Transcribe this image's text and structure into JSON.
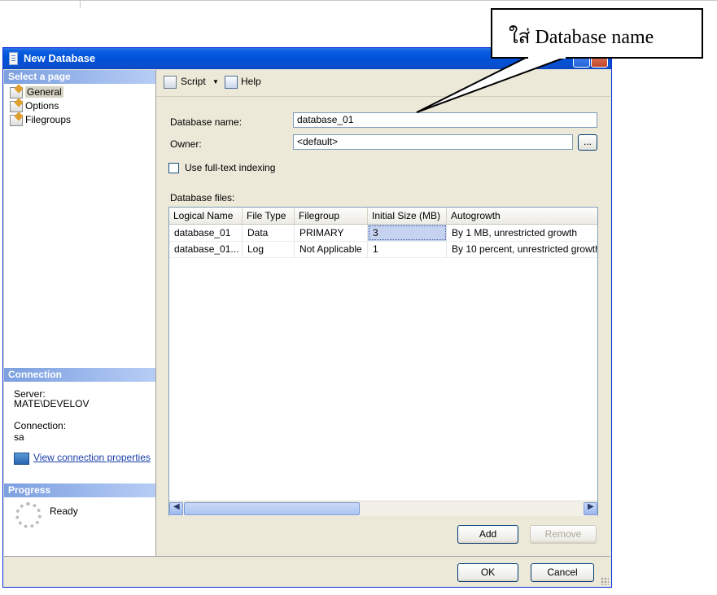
{
  "window": {
    "title": "New Database"
  },
  "left_panel": {
    "select_page_header": "Select a page",
    "pages": [
      {
        "label": "General",
        "selected": true
      },
      {
        "label": "Options",
        "selected": false
      },
      {
        "label": "Filegroups",
        "selected": false
      }
    ],
    "connection_header": "Connection",
    "server_label": "Server:",
    "server_value": "MATE\\DEVELOV",
    "connection_label": "Connection:",
    "connection_value": "sa",
    "view_properties_link": "View connection properties",
    "progress_header": "Progress",
    "progress_status": "Ready"
  },
  "toolbar": {
    "script_label": "Script",
    "help_label": "Help"
  },
  "form": {
    "database_name_label": "Database name:",
    "database_name_value": "database_01",
    "owner_label": "Owner:",
    "owner_value": "<default>",
    "browse_button": "...",
    "fulltext_label": "Use full-text indexing",
    "fulltext_checked": false,
    "database_files_label": "Database files:"
  },
  "files_table": {
    "columns": [
      "Logical Name",
      "File Type",
      "Filegroup",
      "Initial Size (MB)",
      "Autogrowth"
    ],
    "rows": [
      [
        "database_01",
        "Data",
        "PRIMARY",
        "3",
        "By 1 MB, unrestricted growth"
      ],
      [
        "database_01...",
        "Log",
        "Not Applicable",
        "1",
        "By 10 percent, unrestricted growth"
      ]
    ]
  },
  "buttons": {
    "add": "Add",
    "remove": "Remove",
    "ok": "OK",
    "cancel": "Cancel"
  },
  "callout": {
    "text": "ใส่ Database name"
  }
}
